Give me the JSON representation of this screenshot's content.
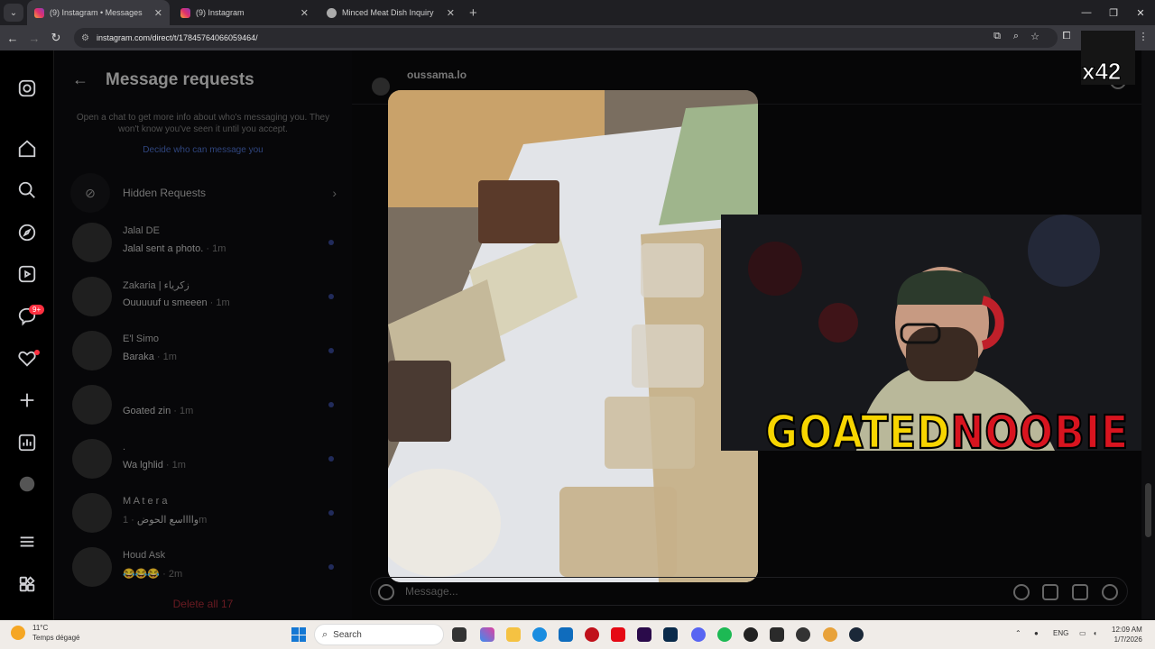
{
  "browser": {
    "tabs": [
      {
        "title": "(9) Instagram • Messages",
        "icon": "instagram-icon",
        "active": true
      },
      {
        "title": "(9) Instagram",
        "icon": "instagram-icon",
        "active": false
      },
      {
        "title": "Minced Meat Dish Inquiry",
        "icon": "web-icon",
        "active": false
      }
    ],
    "url": "instagram.com/direct/t/17845764066059464/"
  },
  "requests": {
    "title": "Message requests",
    "info": "Open a chat to get more info about who's messaging you. They won't know you've seen it until you accept.",
    "link": "Decide who can message you",
    "hidden_label": "Hidden Requests",
    "conversations": [
      {
        "name": "Jalal DE",
        "preview": "Jalal sent a photo.",
        "time": "· 1m"
      },
      {
        "name": "Zakaria | زكرياء",
        "preview": "Ouuuuuf u smeeen",
        "time": "· 1m"
      },
      {
        "name": "E'l Simo",
        "preview": "Baraka",
        "time": "· 1m"
      },
      {
        "name": "",
        "preview": "Goated zin",
        "time": "· 1m"
      },
      {
        "name": ".",
        "preview": "Wa lghlid",
        "time": "· 1m"
      },
      {
        "name": "M A t e r a",
        "preview": "وااااسع الحوض",
        "time": "· 1m"
      },
      {
        "name": "Houd Ask",
        "preview": "😂😂😂",
        "time": "· 2m"
      }
    ],
    "delete_all": "Delete all 17"
  },
  "rail": {
    "badge": "9+"
  },
  "chat": {
    "username": "oussama.lo",
    "placeholder": "Message..."
  },
  "overlay": {
    "logo_part1": "GOATED",
    "logo_part2": "NOOBIE",
    "counter": "x42"
  },
  "taskbar": {
    "temp": "11°C",
    "condition": "Temps dégagé",
    "search": "Search",
    "lang": "ENG",
    "time": "12:09 AM",
    "date": "1/7/2026"
  },
  "colors": {
    "accent_red": "#ff3040",
    "logo_yellow": "#f7d500",
    "logo_red": "#d8141f"
  }
}
